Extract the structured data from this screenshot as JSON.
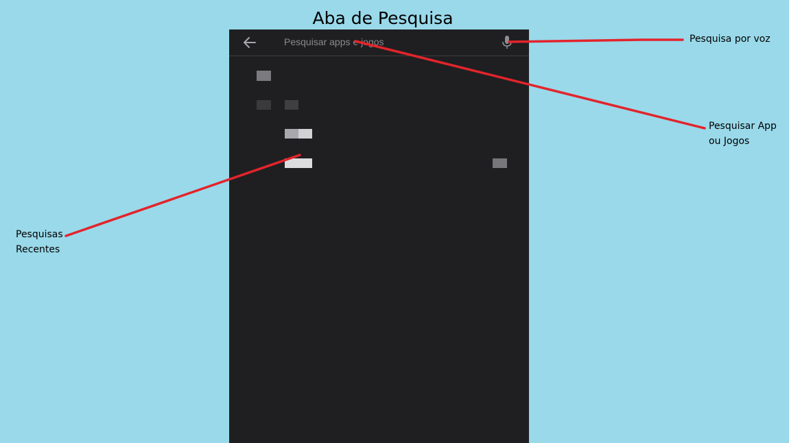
{
  "page": {
    "title": "Aba de Pesquisa"
  },
  "search_bar": {
    "back_icon": "arrow-left-icon",
    "placeholder": "Pesquisar apps e jogos",
    "value": "",
    "mic_icon": "microphone-icon"
  },
  "annotations": {
    "voice_search": "Pesquisa por voz",
    "search_apps_line1": "Pesquisar App",
    "search_apps_line2": "ou Jogos",
    "recent_searches_line1": "Pesquisas",
    "recent_searches_line2": "Recentes"
  },
  "colors": {
    "background": "#99d9ea",
    "screen": "#1f1f21",
    "annotation_line": "#e3242b"
  }
}
